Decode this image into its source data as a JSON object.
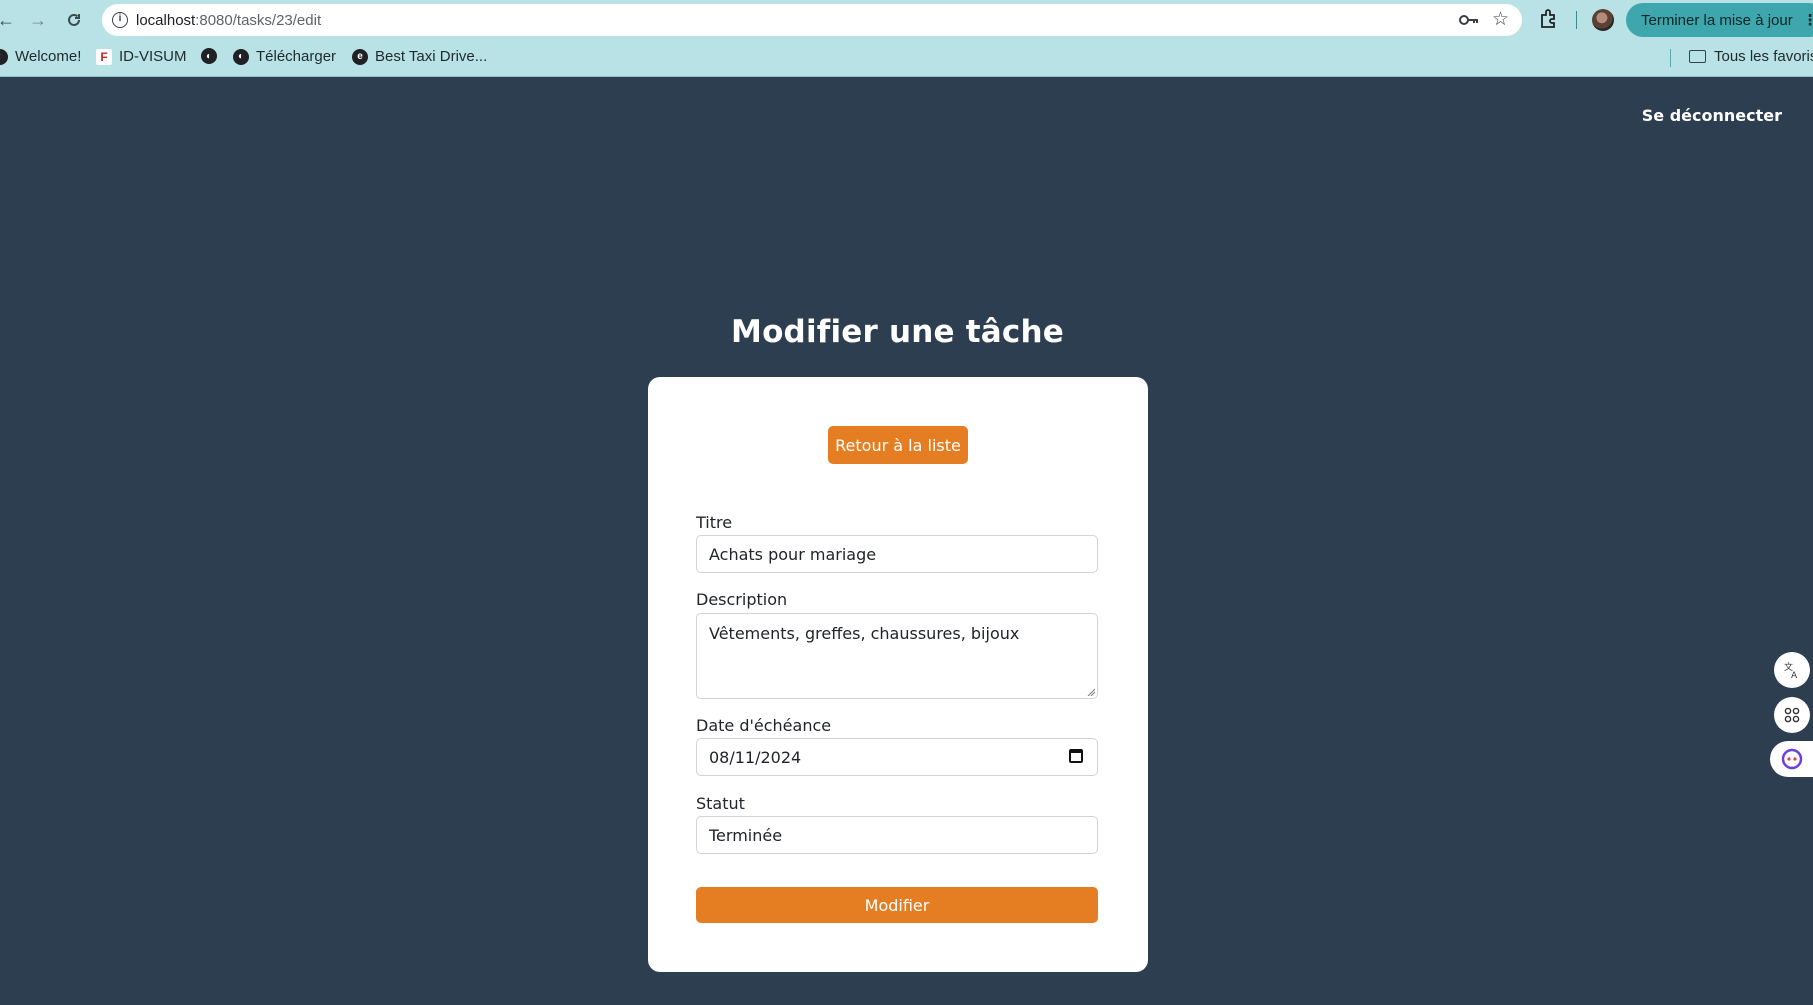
{
  "browser": {
    "url_host": "localhost",
    "url_path": ":8080/tasks/23/edit",
    "update_button_label": "Terminer la mise à jour",
    "update_menu": "⋮"
  },
  "bookmarks": {
    "items": [
      {
        "label": "Welcome!"
      },
      {
        "label": "ID-VISUM"
      },
      {
        "label": ""
      },
      {
        "label": "Télécharger"
      },
      {
        "label": "Best Taxi Drive..."
      }
    ],
    "all_bookmarks": "Tous les favoris"
  },
  "header": {
    "logout_label": "Se déconnecter"
  },
  "main": {
    "title": "Modifier une tâche",
    "back_button": "Retour à la liste",
    "form": {
      "title_label": "Titre",
      "title_value": "Achats pour mariage",
      "description_label": "Description",
      "description_value": "Vêtements, greffes, chaussures, bijoux",
      "due_date_label": "Date d'échéance",
      "due_date_value": "08/11/2024",
      "status_label": "Statut",
      "status_value": "Terminée",
      "submit_label": "Modifier"
    }
  },
  "colors": {
    "page_bg": "#2e3e51",
    "accent": "#e57e22",
    "chrome_bg": "#b9e2e6"
  }
}
